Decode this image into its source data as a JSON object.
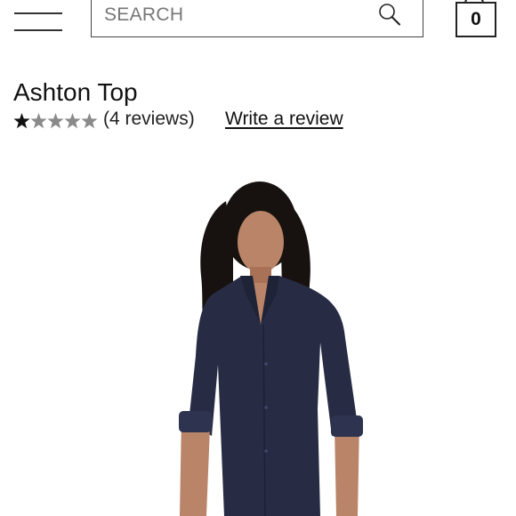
{
  "header": {
    "search": {
      "placeholder": "SEARCH"
    },
    "cart": {
      "count": "0"
    }
  },
  "product": {
    "title": "Ashton Top",
    "rating": {
      "stars_filled": 1,
      "stars_total": 5,
      "reviews_text": "(4 reviews)"
    },
    "write_review_label": "Write a review",
    "image": {
      "subject": "model wearing navy button-up top"
    }
  },
  "colors": {
    "text": "#111111",
    "border": "#444444",
    "star_filled": "#111111",
    "star_empty": "#8a8a8a",
    "shirt": "#272c44",
    "hair": "#17120f",
    "skin": "#b98468"
  }
}
